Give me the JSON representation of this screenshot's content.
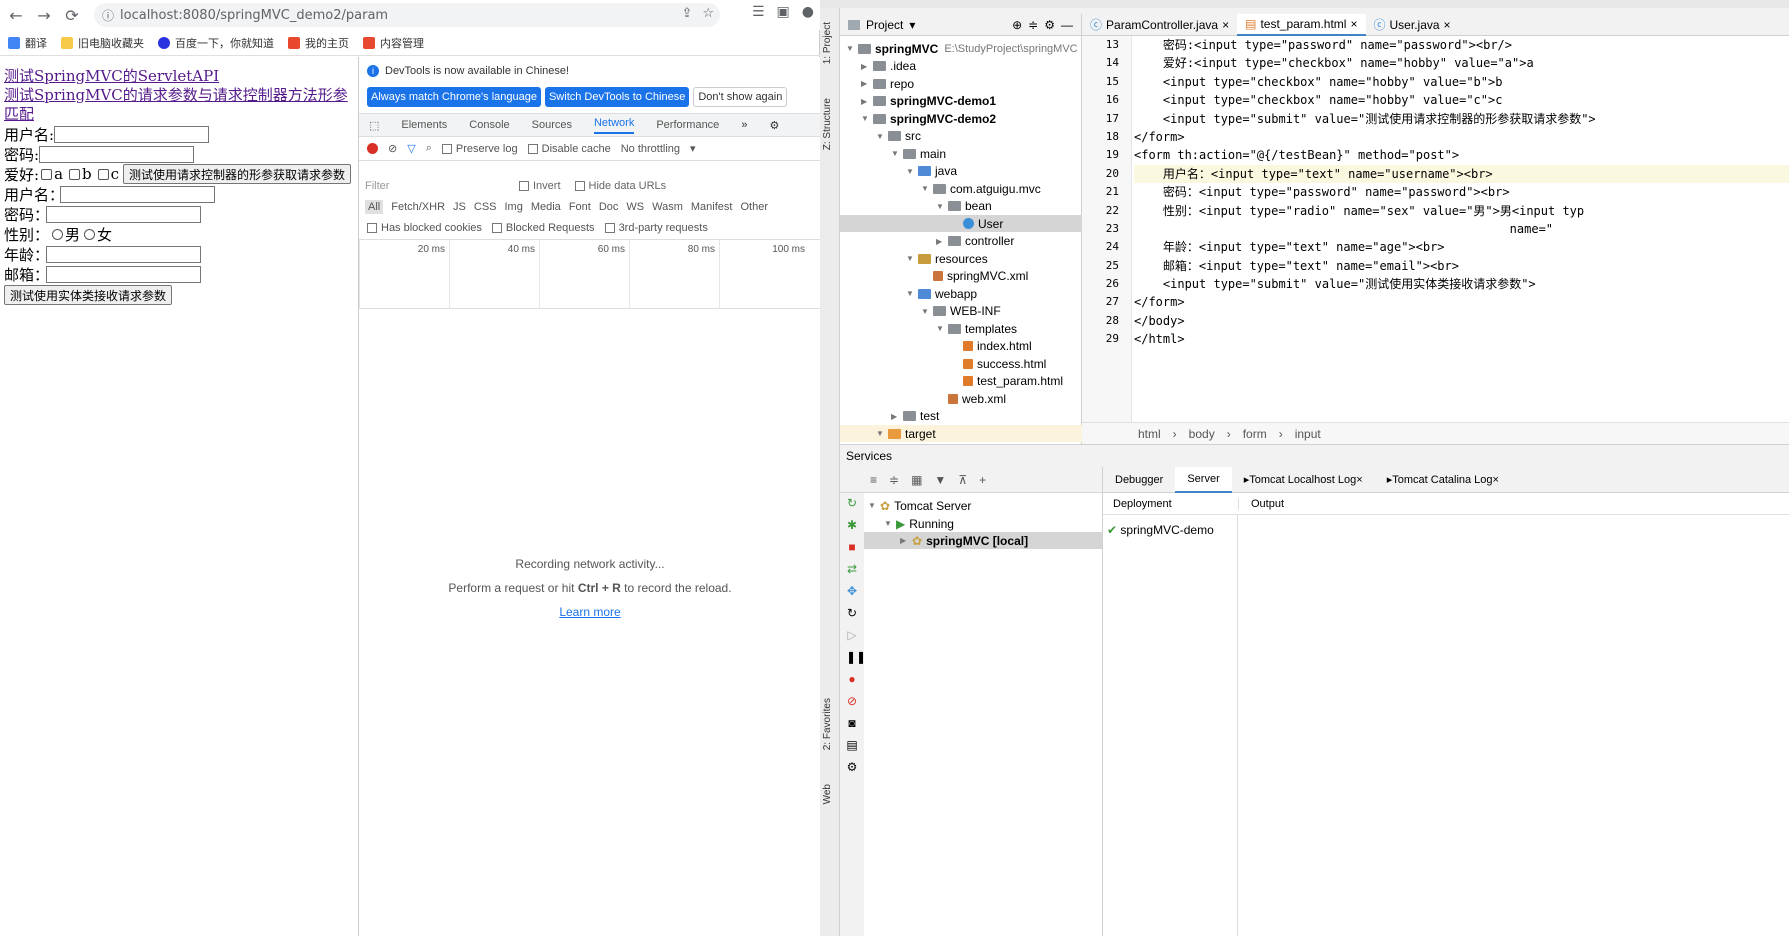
{
  "browser": {
    "url": "localhost:8080/springMVC_demo2/param",
    "bookmarks": [
      "翻译",
      "旧电脑收藏夹",
      "百度一下，你就知道",
      "我的主页",
      "内容管理"
    ]
  },
  "page": {
    "link1": "测试SpringMVC的ServletAPI",
    "link2": "测试SpringMVC的请求参数与请求控制器方法形参匹配",
    "form1": {
      "username": "用户名:",
      "password": "密码:",
      "hobby": "爱好:",
      "opt_a": "a",
      "opt_b": "b",
      "opt_c": "c",
      "submit": "测试使用请求控制器的形参获取请求参数"
    },
    "form2": {
      "username": "用户名：",
      "password": "密码：",
      "sex": "性别：",
      "male": "男",
      "female": "女",
      "age": "年龄：",
      "email": "邮箱：",
      "submit": "测试使用实体类接收请求参数"
    }
  },
  "devtools": {
    "info": "DevTools is now available in Chinese!",
    "btn_match": "Always match Chrome's language",
    "btn_switch": "Switch DevTools to Chinese",
    "btn_dont": "Don't show again",
    "tabs": [
      "Elements",
      "Console",
      "Sources",
      "Network",
      "Performance"
    ],
    "preserve": "Preserve log",
    "disable_cache": "Disable cache",
    "throttling": "No throttling",
    "filter_ph": "Filter",
    "invert": "Invert",
    "hide_urls": "Hide data URLs",
    "types": [
      "All",
      "Fetch/XHR",
      "JS",
      "CSS",
      "Img",
      "Media",
      "Font",
      "Doc",
      "WS",
      "Wasm",
      "Manifest",
      "Other"
    ],
    "blocked_cookies": "Has blocked cookies",
    "blocked_requests": "Blocked Requests",
    "third_party": "3rd-party requests",
    "ticks": [
      "20 ms",
      "40 ms",
      "60 ms",
      "80 ms",
      "100 ms"
    ],
    "recording": "Recording network activity...",
    "perform_pre": "Perform a request or hit ",
    "perform_keys": "Ctrl + R",
    "perform_post": " to record the reload.",
    "learn": "Learn more"
  },
  "ide": {
    "project_label": "Project",
    "side_project": "1: Project",
    "side_structure": "Z: Structure",
    "side_favorites": "2: Favorites",
    "side_web": "Web",
    "tree": [
      {
        "t": "springMVC",
        "sub": "E:\\StudyProject\\springMVC",
        "d": 0,
        "b": true
      },
      {
        "t": ".idea",
        "d": 1
      },
      {
        "t": "repo",
        "d": 1
      },
      {
        "t": "springMVC-demo1",
        "d": 1,
        "b": true
      },
      {
        "t": "springMVC-demo2",
        "d": 1,
        "b": true
      },
      {
        "t": "src",
        "d": 2
      },
      {
        "t": "main",
        "d": 3
      },
      {
        "t": "java",
        "d": 4
      },
      {
        "t": "com.atguigu.mvc",
        "d": 5
      },
      {
        "t": "bean",
        "d": 6
      },
      {
        "t": "User",
        "d": 7,
        "sel": true
      },
      {
        "t": "controller",
        "d": 6
      },
      {
        "t": "resources",
        "d": 4
      },
      {
        "t": "springMVC.xml",
        "d": 5
      },
      {
        "t": "webapp",
        "d": 4
      },
      {
        "t": "WEB-INF",
        "d": 5
      },
      {
        "t": "templates",
        "d": 6
      },
      {
        "t": "index.html",
        "d": 7
      },
      {
        "t": "success.html",
        "d": 7
      },
      {
        "t": "test_param.html",
        "d": 7
      },
      {
        "t": "web.xml",
        "d": 6
      },
      {
        "t": "test",
        "d": 3
      },
      {
        "t": "target",
        "d": 2
      }
    ],
    "tabs": [
      "ParamController.java",
      "test_param.html",
      "User.java"
    ],
    "lines": [
      "13",
      "14",
      "15",
      "16",
      "17",
      "18",
      "19",
      "20",
      "21",
      "22",
      "23",
      "24",
      "25",
      "26",
      "27",
      "28",
      "29"
    ],
    "code": [
      "    密码:<input type=\"password\" name=\"password\"><br/>",
      "    爱好:<input type=\"checkbox\" name=\"hobby\" value=\"a\">a",
      "    <input type=\"checkbox\" name=\"hobby\" value=\"b\">b",
      "    <input type=\"checkbox\" name=\"hobby\" value=\"c\">c",
      "    <input type=\"submit\" value=\"测试使用请求控制器的形参获取请求参数\">",
      "</form>",
      "<form th:action=\"@{/testBean}\" method=\"post\">",
      "    用户名：<input type=\"text\" name=\"username\"><br>",
      "    密码：<input type=\"password\" name=\"password\"><br>",
      "    性别：<input type=\"radio\" name=\"sex\" value=\"男\">男<input typ",
      "                                                    name=\"",
      "    年龄：<input type=\"text\" name=\"age\"><br>",
      "    邮箱：<input type=\"text\" name=\"email\"><br>",
      "    <input type=\"submit\" value=\"测试使用实体类接收请求参数\">",
      "</form>",
      "</body>",
      "</html>"
    ],
    "crumbs": [
      "html",
      "body",
      "form",
      "input"
    ],
    "services": "Services",
    "svc_tree": [
      "Tomcat Server",
      "Running",
      "springMVC [local]"
    ],
    "svc_tabs": [
      "Debugger",
      "Server",
      "Tomcat Localhost Log",
      "Tomcat Catalina Log"
    ],
    "deployment": "Deployment",
    "output": "Output",
    "deploy_item": "springMVC-demo"
  },
  "colors": {
    "accent": "#1a73e8",
    "link": "#551a8b",
    "ide_select": "#d5d5d5"
  }
}
